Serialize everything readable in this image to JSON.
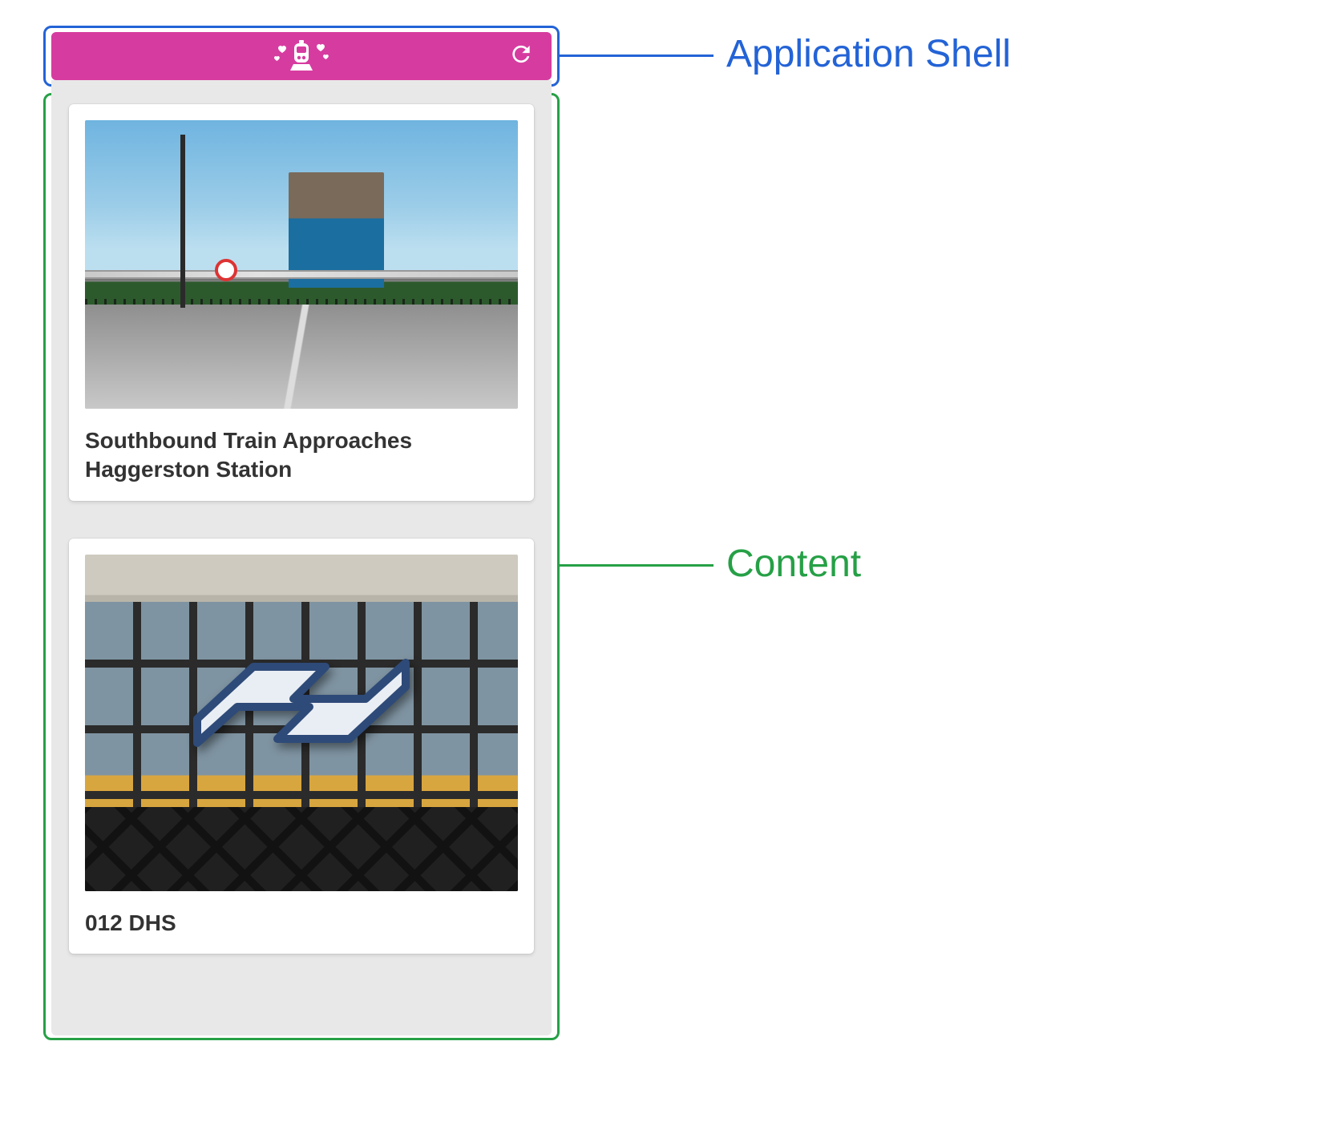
{
  "annotations": {
    "shell_label": "Application Shell",
    "content_label": "Content"
  },
  "colors": {
    "shell_annotation": "#2363d6",
    "content_annotation": "#26a046",
    "app_bar": "#d63ca0"
  },
  "app_shell": {
    "logo_icon": "train-hearts-icon",
    "refresh_icon": "refresh-icon"
  },
  "content": {
    "cards": [
      {
        "title": "Southbound Train Approaches Haggerston Station"
      },
      {
        "title": "012 DHS"
      }
    ]
  }
}
